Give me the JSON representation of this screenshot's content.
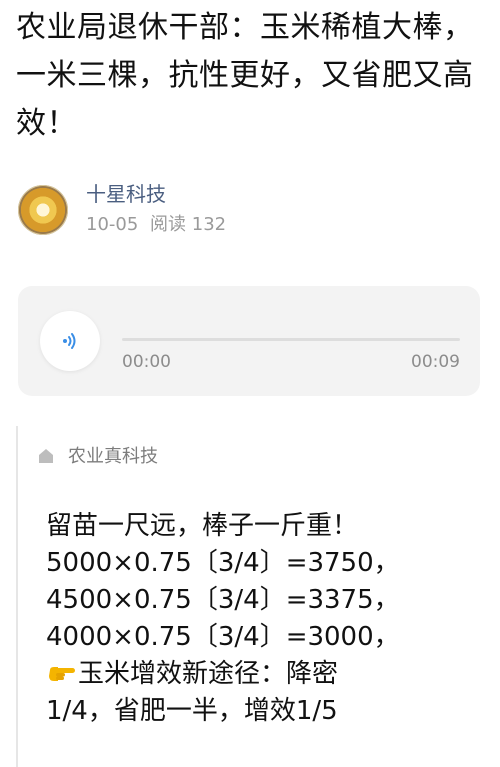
{
  "article": {
    "title": "农业局退休干部：玉米稀植大棒，一米三棵，抗性更好，又省肥又高效！"
  },
  "author": {
    "name": "十星科技",
    "date": "10-05",
    "reads": "阅读 132"
  },
  "audio": {
    "current_time": "00:00",
    "duration": "00:09",
    "progress": 0
  },
  "quote": {
    "source": "农业真科技",
    "lines": [
      "留苗一尺远，棒子一斤重！",
      "5000×0.75〔3/4〕=3750，",
      "4500×0.75〔3/4〕=3375，",
      "4000×0.75〔3/4〕=3000，",
      "玉米增效新途径：降密",
      "1/4，省肥一半，增效1/5"
    ]
  },
  "icons": {
    "play": "sound-wave-icon",
    "source": "home-icon",
    "pointer": "pointing-hand-icon"
  },
  "colors": {
    "author": "#4a5e80",
    "play_icon": "#3a8ee6",
    "card_bg": "#f3f3f3"
  }
}
